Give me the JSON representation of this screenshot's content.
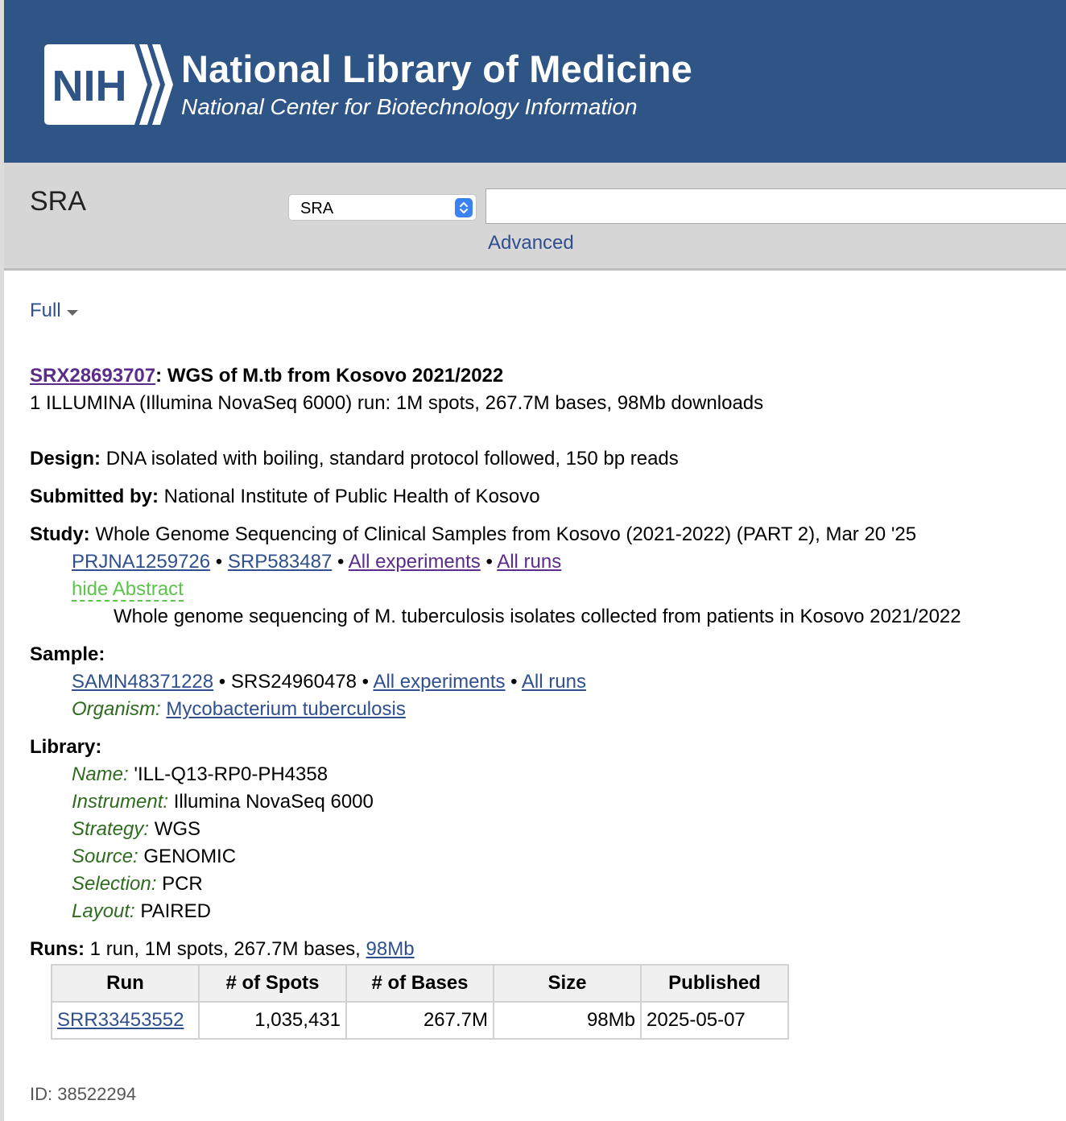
{
  "header": {
    "logo_text": "NIH",
    "title": "National Library of Medicine",
    "subtitle": "National Center for Biotechnology Information"
  },
  "search": {
    "database_name": "SRA",
    "selected_db": "SRA",
    "query": "",
    "advanced_label": "Advanced"
  },
  "format_toggle": "Full",
  "record": {
    "accession": "SRX28693707",
    "title_sep": ": ",
    "title": "WGS of M.tb from Kosovo 2021/2022",
    "summary": "1 ILLUMINA (Illumina NovaSeq 6000) run: 1M spots, 267.7M bases, 98Mb downloads"
  },
  "design": {
    "label": "Design:",
    "value": "DNA isolated with boiling, standard protocol followed, 150 bp reads"
  },
  "submitted_by": {
    "label": "Submitted by:",
    "value": "National Institute of Public Health of Kosovo"
  },
  "study": {
    "label": "Study:",
    "value": "Whole Genome Sequencing of Clinical Samples from Kosovo (2021-2022) (PART 2), Mar 20 '25",
    "bioproject": "PRJNA1259726",
    "srp": "SRP583487",
    "all_experiments": "All experiments",
    "all_runs": "All runs",
    "separator": " • ",
    "hide_abstract": "hide Abstract",
    "abstract": "Whole genome sequencing of M. tuberculosis isolates collected from patients in Kosovo 2021/2022"
  },
  "sample": {
    "label": "Sample:",
    "biosample": "SAMN48371228",
    "srs": "SRS24960478",
    "all_experiments": "All experiments",
    "all_runs": "All runs",
    "organism_label": "Organism:",
    "organism": "Mycobacterium tuberculosis"
  },
  "library": {
    "label": "Library:",
    "fields": [
      {
        "label": "Name:",
        "value": "'ILL-Q13-RP0-PH4358"
      },
      {
        "label": "Instrument:",
        "value": "Illumina NovaSeq 6000"
      },
      {
        "label": "Strategy:",
        "value": "WGS"
      },
      {
        "label": "Source:",
        "value": "GENOMIC"
      },
      {
        "label": "Selection:",
        "value": "PCR"
      },
      {
        "label": "Layout:",
        "value": "PAIRED"
      }
    ]
  },
  "runs": {
    "label": "Runs:",
    "summary": "1 run, 1M spots, 267.7M bases,",
    "download_link": "98Mb",
    "table": {
      "headers": [
        "Run",
        "# of Spots",
        "# of Bases",
        "Size",
        "Published"
      ],
      "rows": [
        {
          "run": "SRR33453552",
          "spots": "1,035,431",
          "bases": "267.7M",
          "size": "98Mb",
          "published": "2025-05-07"
        }
      ]
    }
  },
  "record_id": "ID: 38522294",
  "colors": {
    "header_bg": "#2f5587",
    "search_bar_bg": "#d6d6d6",
    "link": "#2f4f8f",
    "visited_link": "#5b2b8a",
    "field_label": "#2e6b1f",
    "hide_abstract": "#5cc44a"
  }
}
